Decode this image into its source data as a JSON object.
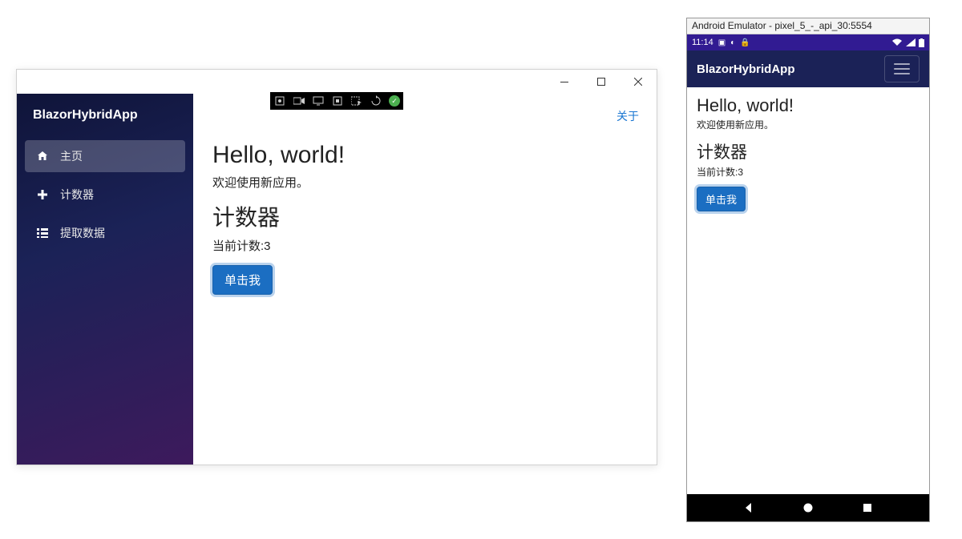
{
  "desktop": {
    "toolbar_icons": [
      "settings-icon",
      "record-icon",
      "display-icon",
      "screenshot-icon",
      "selector-icon",
      "sync-icon",
      "check-icon"
    ],
    "brand": "BlazorHybridApp",
    "nav": [
      {
        "label": "主页",
        "icon": "home-icon",
        "active": true
      },
      {
        "label": "计数器",
        "icon": "plus-icon",
        "active": false
      },
      {
        "label": "提取数据",
        "icon": "list-icon",
        "active": false
      }
    ],
    "about": "关于",
    "heading": "Hello, world!",
    "welcome": "欢迎使用新应用。",
    "counter_heading": "计数器",
    "count_label": "当前计数:",
    "count_value": "3",
    "button": "单击我"
  },
  "emulator": {
    "title": "Android Emulator - pixel_5_-_api_30:5554",
    "time": "11:14",
    "brand": "BlazorHybridApp",
    "heading": "Hello, world!",
    "welcome": "欢迎使用新应用。",
    "counter_heading": "计数器",
    "count_label": "当前计数:",
    "count_value": "3",
    "button": "单击我"
  }
}
